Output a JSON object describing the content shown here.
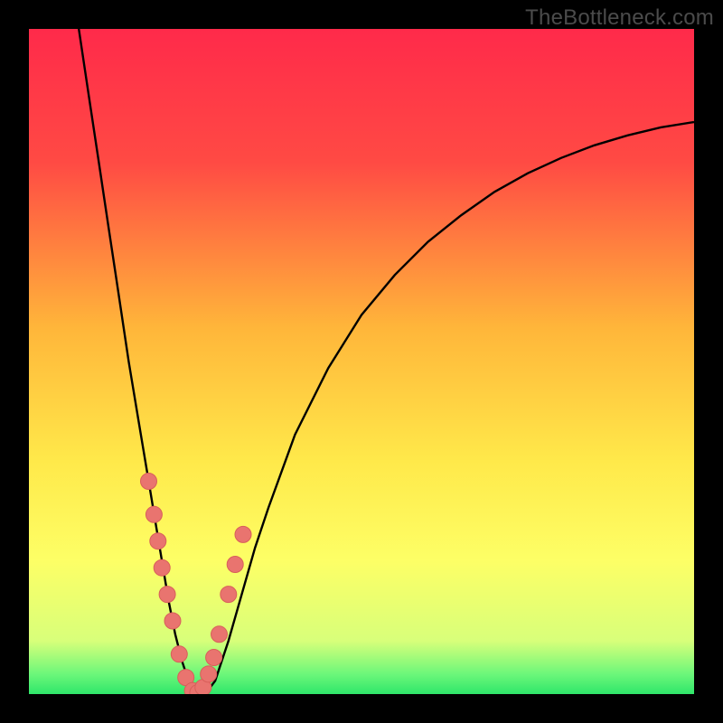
{
  "watermark": "TheBottleneck.com",
  "colors": {
    "frame": "#000000",
    "gradient_stops": [
      {
        "pct": 0,
        "color": "#ff2a4a"
      },
      {
        "pct": 20,
        "color": "#ff4a44"
      },
      {
        "pct": 45,
        "color": "#ffb63a"
      },
      {
        "pct": 65,
        "color": "#ffe94a"
      },
      {
        "pct": 80,
        "color": "#fdff66"
      },
      {
        "pct": 92,
        "color": "#d8ff7a"
      },
      {
        "pct": 97,
        "color": "#6cf77a"
      },
      {
        "pct": 100,
        "color": "#2fe66a"
      }
    ],
    "curve": "#000000",
    "marker_fill": "#e9746f",
    "marker_stroke": "#d85f5a"
  },
  "chart_data": {
    "type": "line",
    "title": "",
    "xlabel": "",
    "ylabel": "",
    "xlim": [
      0,
      100
    ],
    "ylim": [
      0,
      100
    ],
    "grid": false,
    "series": [
      {
        "name": "bottleneck-curve",
        "x_norm_0_100": [
          7.5,
          9.0,
          10.5,
          12.0,
          13.5,
          15.0,
          16.5,
          18.0,
          19.0,
          20.0,
          21.0,
          22.0,
          23.0,
          24.0,
          25.0,
          26.5,
          28.0,
          30.0,
          32.0,
          34.0,
          36.0,
          40.0,
          45.0,
          50.0,
          55.0,
          60.0,
          65.0,
          70.0,
          75.0,
          80.0,
          85.0,
          90.0,
          95.0,
          100.0
        ],
        "y_bottleneck_pct": [
          100.0,
          90.0,
          80.0,
          70.0,
          60.0,
          50.0,
          41.0,
          32.0,
          26.0,
          20.0,
          14.0,
          9.0,
          5.0,
          2.0,
          0.0,
          0.0,
          2.0,
          8.0,
          15.0,
          22.0,
          28.0,
          39.0,
          49.0,
          57.0,
          63.0,
          68.0,
          72.0,
          75.5,
          78.3,
          80.6,
          82.5,
          84.0,
          85.2,
          86.0
        ]
      }
    ],
    "markers": {
      "name": "observations",
      "x_norm_0_100": [
        18.0,
        18.8,
        19.4,
        20.0,
        20.8,
        21.6,
        22.6,
        23.6,
        24.6,
        25.4,
        26.2,
        27.0,
        27.8,
        28.6,
        30.0,
        31.0,
        32.2
      ],
      "y_bottleneck_pct": [
        32.0,
        27.0,
        23.0,
        19.0,
        15.0,
        11.0,
        6.0,
        2.5,
        0.5,
        0.2,
        1.0,
        3.0,
        5.5,
        9.0,
        15.0,
        19.5,
        24.0
      ]
    }
  }
}
